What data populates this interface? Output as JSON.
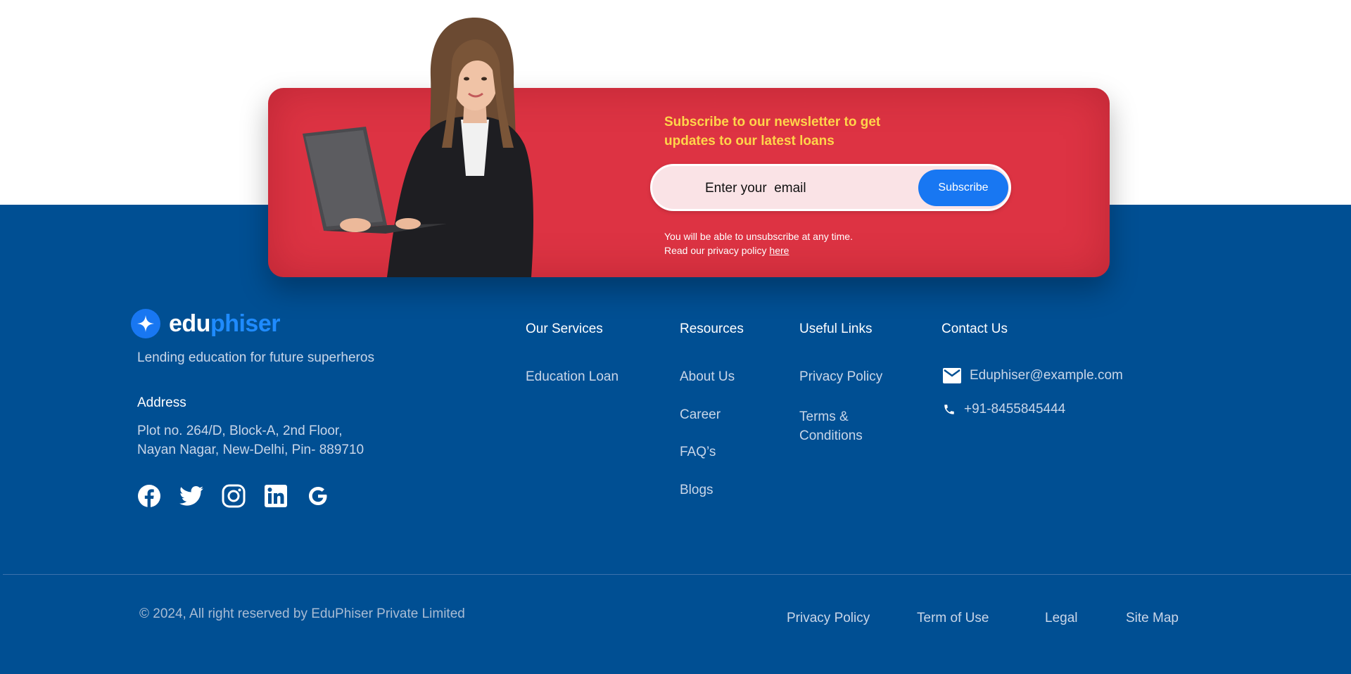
{
  "newsletter": {
    "title_line1": "Subscribe to our newsletter to get",
    "title_line2": "updates to our latest loans",
    "email_placeholder": "Enter your  email",
    "subscribe_label": "Subscribe",
    "unsub_line1": "You will be able to unsubscribe at any time.",
    "unsub_line2": "Read our privacy policy ",
    "unsub_link": "here"
  },
  "brand": {
    "logo_part1": "edu",
    "logo_part2": "phiser",
    "tagline": "Lending education for future superheros",
    "address_heading": "Address",
    "address_line1": "Plot no. 264/D, Block-A, 2nd Floor,",
    "address_line2": "Nayan Nagar, New-Delhi, Pin- 889710",
    "socials": [
      "facebook-icon",
      "twitter-icon",
      "instagram-icon",
      "linkedin-icon",
      "google-icon"
    ]
  },
  "columns": {
    "services": {
      "heading": "Our Services",
      "items": [
        "Education Loan"
      ]
    },
    "resources": {
      "heading": "Resources",
      "items": [
        "About Us",
        "Career",
        "FAQ’s",
        "Blogs"
      ]
    },
    "useful": {
      "heading": "Useful Links",
      "items": [
        "Privacy Policy",
        "Terms &",
        "Conditions"
      ]
    },
    "contact": {
      "heading": "Contact Us",
      "email": "Eduphiser@example.com",
      "phone": "+91-8455845444"
    }
  },
  "bottom": {
    "copyright": "© 2024, All right reserved by EduPhiser Private Limited",
    "links": [
      "Privacy Policy",
      "Term of Use",
      "Legal",
      "Site Map"
    ]
  },
  "colors": {
    "footer_bg": "#004f93",
    "card_red": "#dd3343",
    "accent_blue": "#1877f2",
    "title_yellow": "#ffd54a"
  }
}
